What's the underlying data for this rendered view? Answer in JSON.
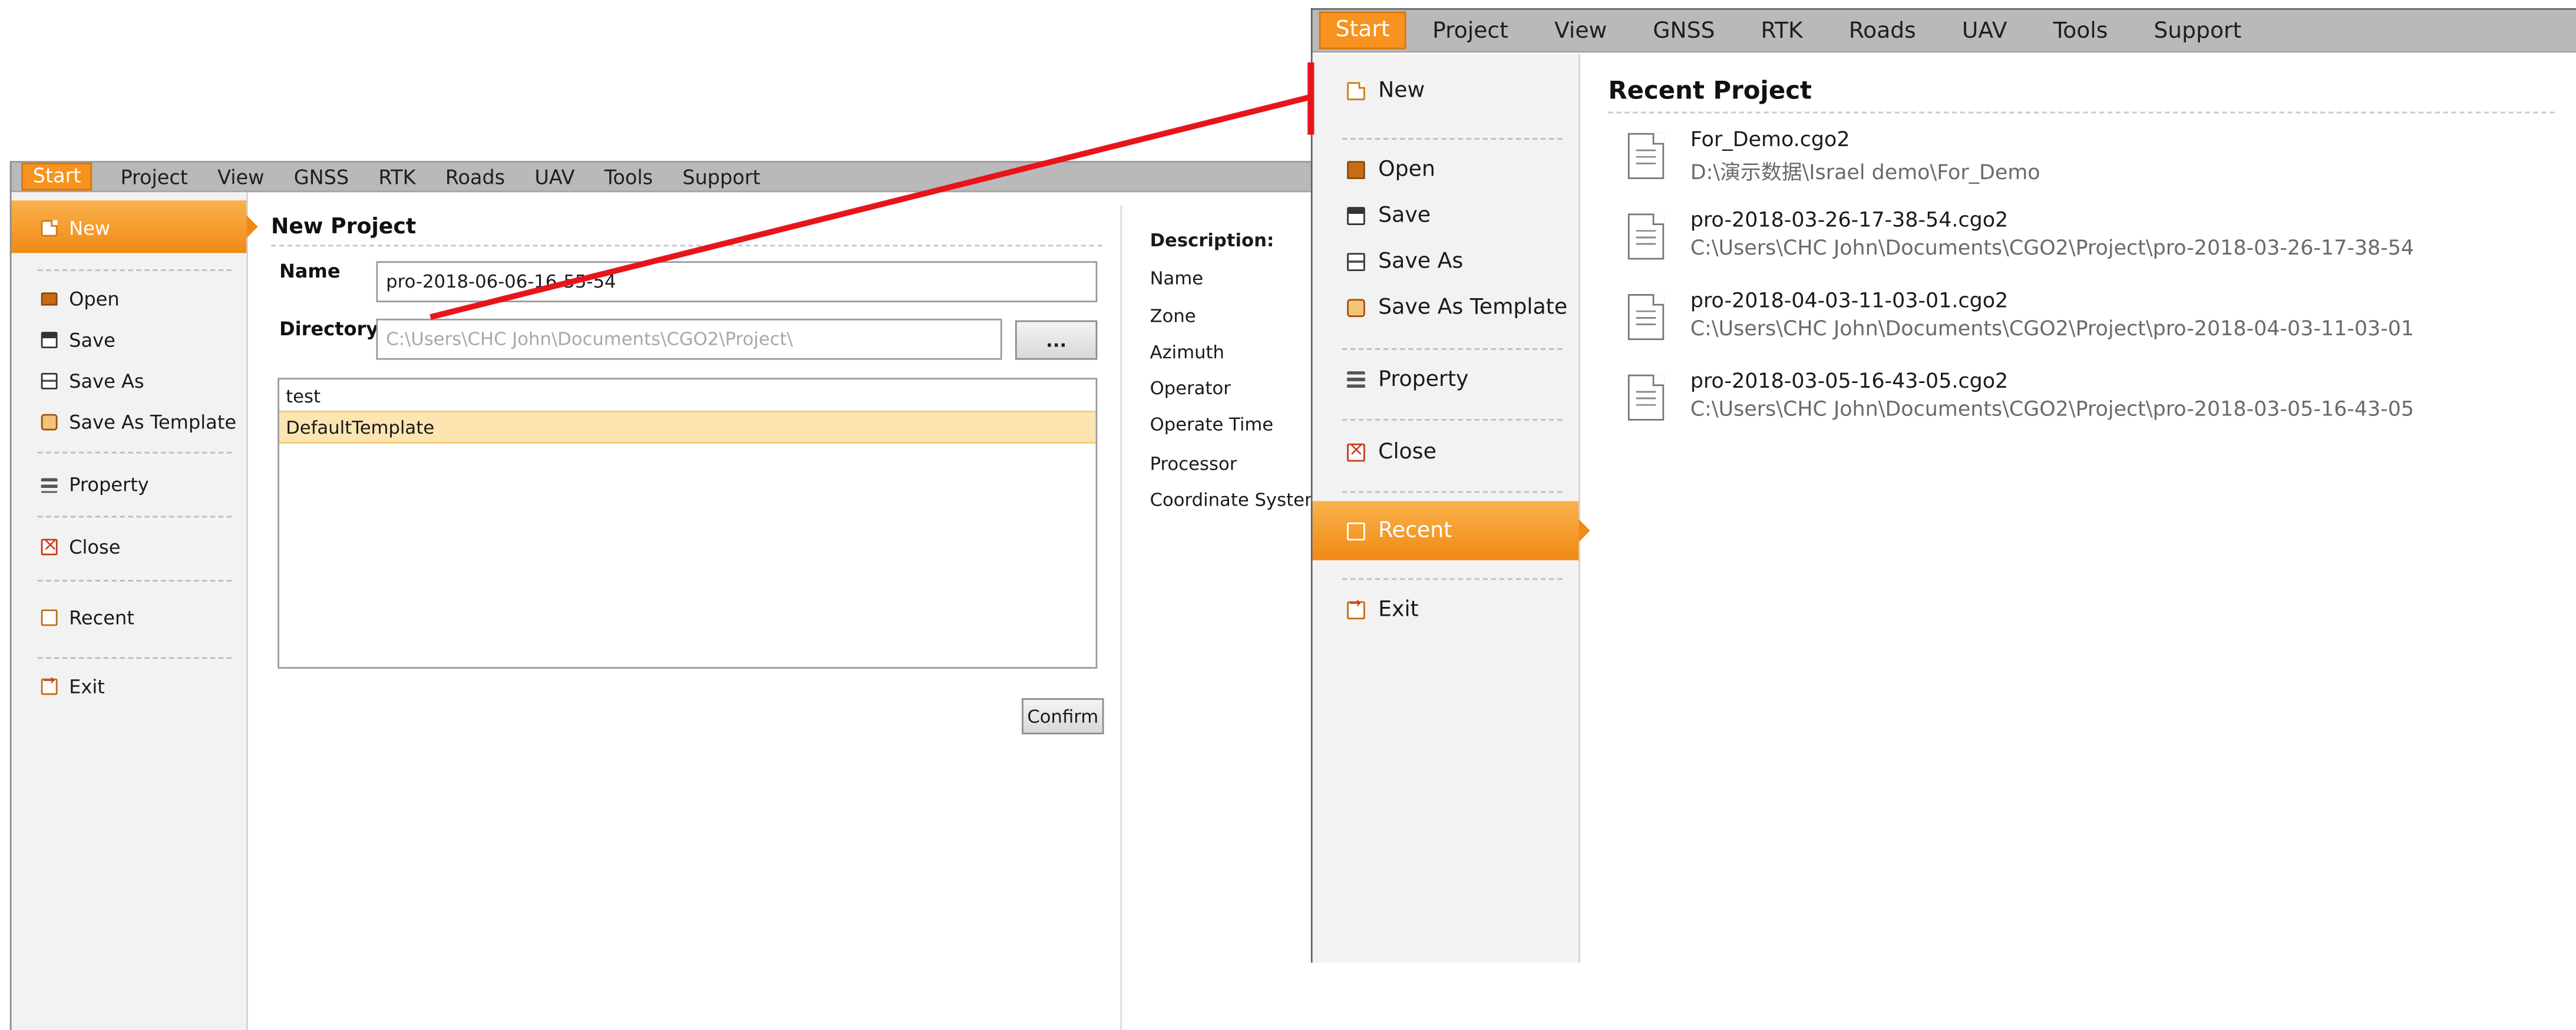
{
  "left_window": {
    "menu": [
      "Start",
      "Project",
      "View",
      "GNSS",
      "RTK",
      "Roads",
      "UAV",
      "Tools",
      "Support"
    ],
    "sidebar": {
      "new": "New",
      "open": "Open",
      "save": "Save",
      "save_as": "Save As",
      "save_as_template": "Save As Template",
      "property": "Property",
      "close": "Close",
      "recent": "Recent",
      "exit": "Exit"
    },
    "title": "New Project",
    "name_label": "Name",
    "name_value": "pro-2018-06-06-16-55-54",
    "directory_label": "Directory",
    "directory_placeholder": "C:\\Users\\CHC John\\Documents\\CGO2\\Project\\",
    "browse_label": "...",
    "templates": [
      "test",
      "DefaultTemplate"
    ],
    "selected_template": "DefaultTemplate",
    "confirm_label": "Confirm",
    "description_title": "Description:",
    "description_fields": [
      "Name",
      "Zone",
      "Azimuth",
      "Operator",
      "Operate Time",
      "Processor",
      "Coordinate System"
    ]
  },
  "right_window": {
    "menu": [
      "Start",
      "Project",
      "View",
      "GNSS",
      "RTK",
      "Roads",
      "UAV",
      "Tools",
      "Support"
    ],
    "sidebar": {
      "new": "New",
      "open": "Open",
      "save": "Save",
      "save_as": "Save As",
      "save_as_template": "Save As Template",
      "property": "Property",
      "close": "Close",
      "recent": "Recent",
      "exit": "Exit"
    },
    "recent_title": "Recent Project",
    "recent_items": [
      {
        "name": "For_Demo.cgo2",
        "path": "D:\\演示数据\\Israel demo\\For_Demo"
      },
      {
        "name": "pro-2018-03-26-17-38-54.cgo2",
        "path": "C:\\Users\\CHC John\\Documents\\CGO2\\Project\\pro-2018-03-26-17-38-54"
      },
      {
        "name": "pro-2018-04-03-11-03-01.cgo2",
        "path": "C:\\Users\\CHC John\\Documents\\CGO2\\Project\\pro-2018-04-03-11-03-01"
      },
      {
        "name": "pro-2018-03-05-16-43-05.cgo2",
        "path": "C:\\Users\\CHC John\\Documents\\CGO2\\Project\\pro-2018-03-05-16-43-05"
      }
    ]
  },
  "colors": {
    "accent_orange": "#f7931e",
    "selected_row": "#fde5b2",
    "callout_line": "#e8141a"
  },
  "icons": [
    "page-icon",
    "folder-open-icon",
    "save-icon",
    "save-as-icon",
    "template-icon",
    "list-icon",
    "close-icon",
    "recent-icon",
    "exit-icon",
    "document-icon"
  ]
}
